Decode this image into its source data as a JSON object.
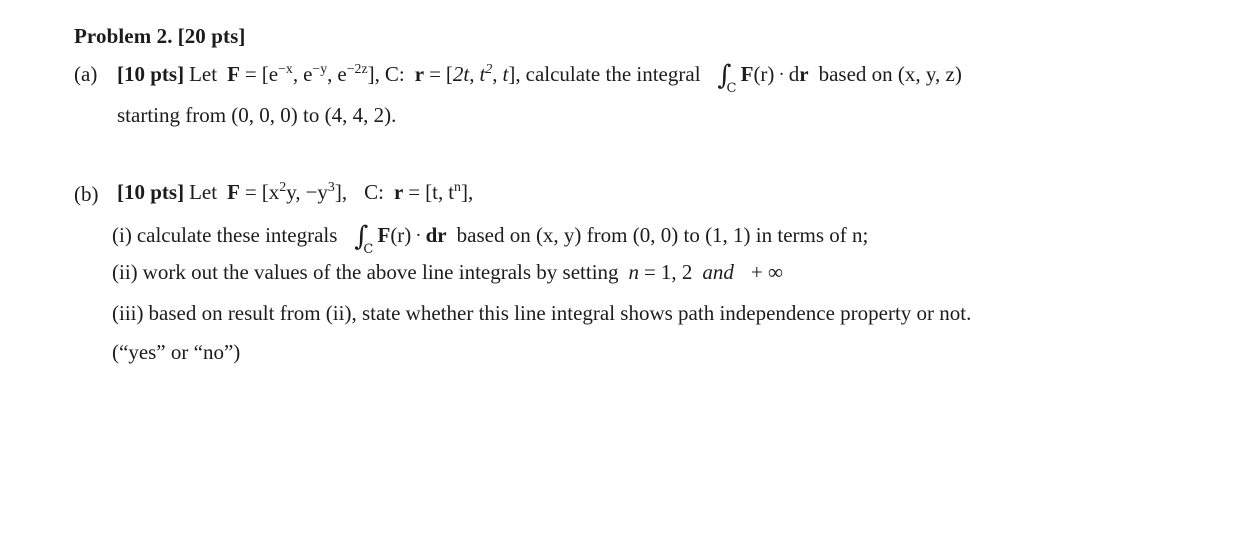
{
  "document": {
    "type": "math-homework-problem",
    "background_color": "#ffffff",
    "text_color": "#1c1c1c"
  },
  "problem": {
    "title": "Problem 2. [20 pts]",
    "title_text": "Problem 2.",
    "title_points": "[20 pts]"
  },
  "parts": {
    "a": {
      "marker": "(a)",
      "points": "[10 pts]",
      "let_word": "Let",
      "field_symbol": "F",
      "field_components": [
        "e",
        "e",
        "e"
      ],
      "field_exponents": [
        "−x",
        "−y",
        "−2z"
      ],
      "field_expression": "F = [e^(−x), e^(−y), e^(−2z)]",
      "curve_label": "C:",
      "curve_symbol": "r",
      "curve_expression": "r = [2t, t^2, t]",
      "curve_components": [
        "2t",
        "t",
        "t"
      ],
      "curve_exponent": "2",
      "instruction": ", calculate the integral",
      "integral_symbol": "∫",
      "integral_subscript": "C",
      "integrand": "F(r) · dr",
      "based_on": "based on (x, y, z)",
      "line2": "starting from (0, 0, 0) to (4, 4, 2).",
      "start_point": "(0, 0, 0)",
      "end_point": "(4, 4, 2)"
    },
    "b": {
      "marker": "(b)",
      "points": "[10 pts]",
      "let_word": "Let",
      "field_symbol": "F",
      "field_expression": "F = [x^2 y, −y^3]",
      "field_term1_base": "x",
      "field_term1_exp": "2",
      "field_term1_var": "y",
      "field_term2": "−y",
      "field_term2_exp": "3",
      "curve_label": "C:",
      "curve_symbol": "r",
      "curve_expression": "r = [t, t^n]",
      "curve_comp1": "t",
      "curve_comp2": "t",
      "curve_exp2": "n",
      "items": {
        "i": {
          "marker": "(i)",
          "text_before": "calculate these integrals",
          "integral_symbol": "∫",
          "integral_subscript": "C",
          "integrand": "F(r) · dr",
          "text_after": "based on (x, y) from (0, 0) to (1, 1) in terms of n;",
          "start_point": "(0, 0)",
          "end_point": "(1, 1)"
        },
        "ii": {
          "marker": "(ii)",
          "text_before": "work out the values of the above line integrals by setting",
          "math_n": "n",
          "math_eq": "=",
          "math_values": "1, 2",
          "math_and": "and",
          "math_plus_inf": "+ ∞",
          "full_text": "work out the values of the above line integrals by setting n = 1, 2 and + ∞"
        },
        "iii": {
          "marker": "(iii)",
          "text": "based on result from (ii), state whether this line integral shows path independence property or not.",
          "note": "(“yes” or “no”)"
        }
      }
    }
  }
}
